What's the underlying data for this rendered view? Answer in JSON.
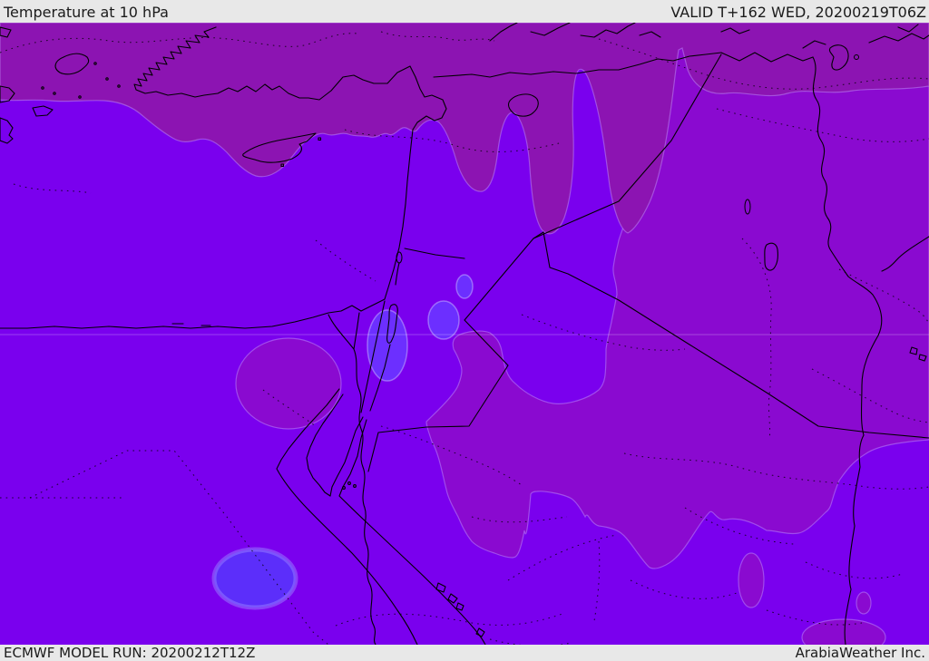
{
  "header": {
    "title": "Temperature at 10 hPa",
    "valid_time": "VALID T+162 WED, 20200219T06Z"
  },
  "footer": {
    "model_run": "ECMWF MODEL RUN: 20200212T12Z",
    "credit": "ArabiaWeather Inc."
  },
  "map": {
    "description": "ECMWF forecast map of temperature at 10 hPa over the Middle East",
    "palette": {
      "band_cold_magenta": "#8c14b2",
      "band_dark_violet": "#8a0ad0",
      "band_bright_violet": "#7a00ee",
      "band_light_violet": "#6c2fff",
      "band_blue": "#5c2efa",
      "coastline": "#000000",
      "gridline": "rgba(255,255,255,0.25)",
      "bar_background": "#e8e8e8",
      "bar_text": "#1b1b1b"
    }
  }
}
